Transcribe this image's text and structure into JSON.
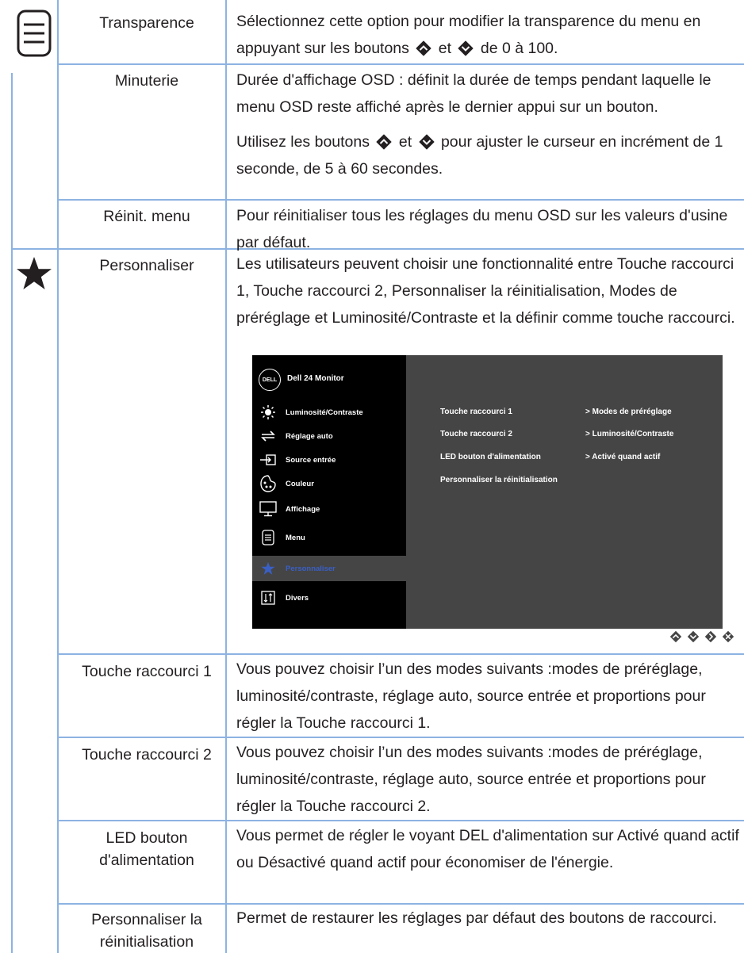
{
  "rows": [
    {
      "term": "Transparence",
      "desc1": "Sélectionnez cette option pour modifier la transparence du menu en appuyant sur les boutons",
      "desc2": "et",
      "desc3": "de 0 à 100."
    },
    {
      "term": "Minuterie",
      "desc": "Durée d'affichage OSD : définit la durée de temps pendant laquelle le menu OSD reste affiché après le dernier appui sur un bouton.",
      "desc_b1": "Utilisez les boutons",
      "desc_b2": "et",
      "desc_b3": "pour ajuster le curseur en incrément de 1 seconde, de 5 à 60 secondes."
    },
    {
      "term": "Réinit. menu",
      "desc": "Pour réinitialiser tous les réglages du menu OSD sur les valeurs d'usine par défaut."
    },
    {
      "term": "Personnaliser",
      "desc": "Les utilisateurs peuvent choisir une fonctionnalité entre Touche raccourci 1, Touche raccourci 2, Personnaliser la réinitialisation, Modes de préréglage et Luminosité/Contraste et la définir comme touche raccourci."
    },
    {
      "term": "Touche raccourci 1",
      "desc": "Vous pouvez choisir l’un des modes suivants :modes de préréglage, luminosité/contraste, réglage auto, source entrée et proportions pour régler la Touche raccourci 1."
    },
    {
      "term": "Touche raccourci 2",
      "desc": "Vous pouvez choisir l’un des modes suivants :modes de préréglage, luminosité/contraste, réglage auto, source entrée et proportions pour régler la Touche raccourci 2."
    },
    {
      "term": "LED bouton d'alimentation",
      "desc": "Vous permet de régler le voyant DEL d'alimentation sur Activé quand actif ou Désactivé quand actif pour économiser de l'énergie."
    },
    {
      "term": "Personnaliser la réinitialisation",
      "desc": "Permet de restaurer les réglages par défaut des boutons de raccourci."
    }
  ],
  "osd": {
    "logo": "DELL",
    "model": "Dell 24 Monitor",
    "menu": [
      {
        "label": "Luminosité/Contraste",
        "icon": "sun-icon"
      },
      {
        "label": "Réglage auto",
        "icon": "auto-adjust-icon"
      },
      {
        "label": "Source entrée",
        "icon": "input-source-icon"
      },
      {
        "label": "Couleur",
        "icon": "color-palette-icon"
      },
      {
        "label": "Affichage",
        "icon": "monitor-icon"
      },
      {
        "label": "Menu",
        "icon": "menu-icon"
      },
      {
        "label": "Personnaliser",
        "icon": "star-icon",
        "selected": true
      },
      {
        "label": "Divers",
        "icon": "others-icon"
      }
    ],
    "options": [
      {
        "label": "Touche raccourci 1",
        "value": "> Modes de préréglage"
      },
      {
        "label": "Touche raccourci 2",
        "value": "> Luminosité/Contraste"
      },
      {
        "label": "LED bouton d'alimentation",
        "value": "> Activé quand actif"
      },
      {
        "label": "Personnaliser la réinitialisation",
        "value": ""
      }
    ],
    "buttons": [
      "up-button-icon",
      "down-button-icon",
      "right-button-icon",
      "close-button-icon"
    ]
  },
  "colors": {
    "rule": "#8db3e2",
    "osd_bg": "#454545",
    "osd_sidebar": "#000000",
    "osd_selected": "#3a5fc4"
  }
}
